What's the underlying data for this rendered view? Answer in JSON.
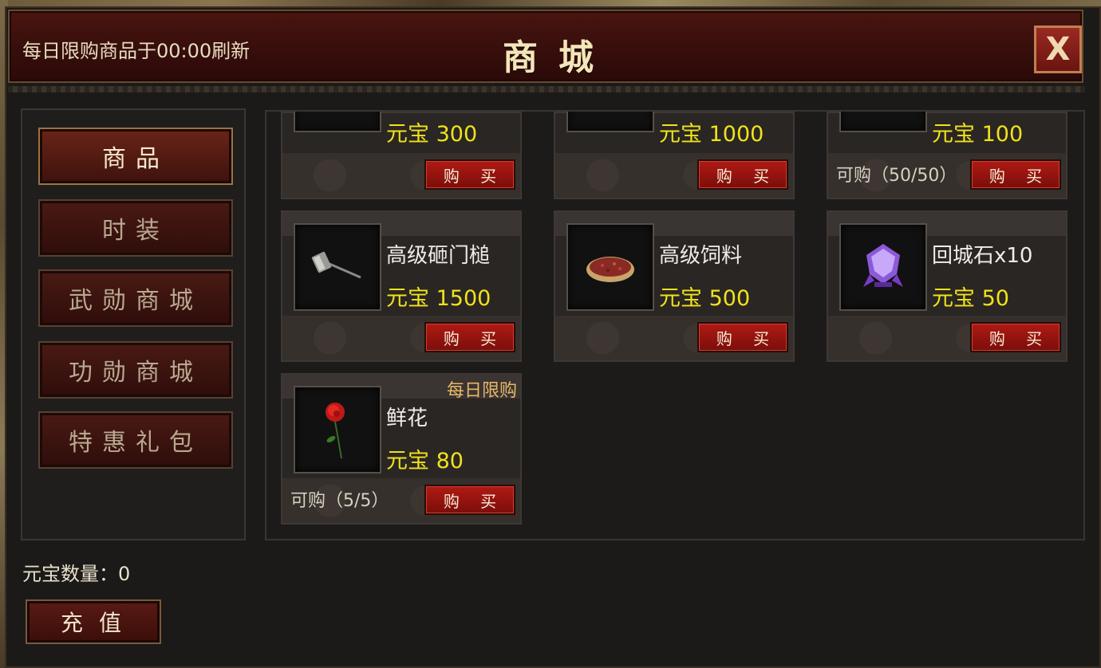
{
  "header": {
    "notice": "每日限购商品于00:00刷新",
    "title": "商城",
    "close_label": "X"
  },
  "nav": {
    "items": [
      {
        "label": "商品",
        "active": true
      },
      {
        "label": "时装",
        "active": false
      },
      {
        "label": "武勋商城",
        "active": false
      },
      {
        "label": "功勋商城",
        "active": false
      },
      {
        "label": "特惠礼包",
        "active": false
      }
    ]
  },
  "shop": {
    "buy_label": "购 买",
    "row0": [
      {
        "price": "元宝 300",
        "limit": ""
      },
      {
        "price": "元宝 1000",
        "limit": ""
      },
      {
        "price": "元宝 100",
        "limit": "可购（50/50）"
      }
    ],
    "row1": [
      {
        "name": "高级砸门槌",
        "price": "元宝 1500",
        "icon": "hammer-icon"
      },
      {
        "name": "高级饲料",
        "price": "元宝 500",
        "icon": "feed-icon"
      },
      {
        "name": "回城石x10",
        "price": "元宝 50",
        "icon": "crystal-icon"
      }
    ],
    "row2": [
      {
        "name": "鲜花",
        "price": "元宝 80",
        "icon": "rose-icon",
        "tag": "每日限购",
        "limit": "可购（5/5）"
      }
    ]
  },
  "footer": {
    "currency_label": "元宝数量：0",
    "recharge_label": "充值"
  },
  "colors": {
    "price": "#f0e21a",
    "buy_button": "#b01a14",
    "header": "#3a0f0c",
    "daily_tag": "#e8b866"
  }
}
